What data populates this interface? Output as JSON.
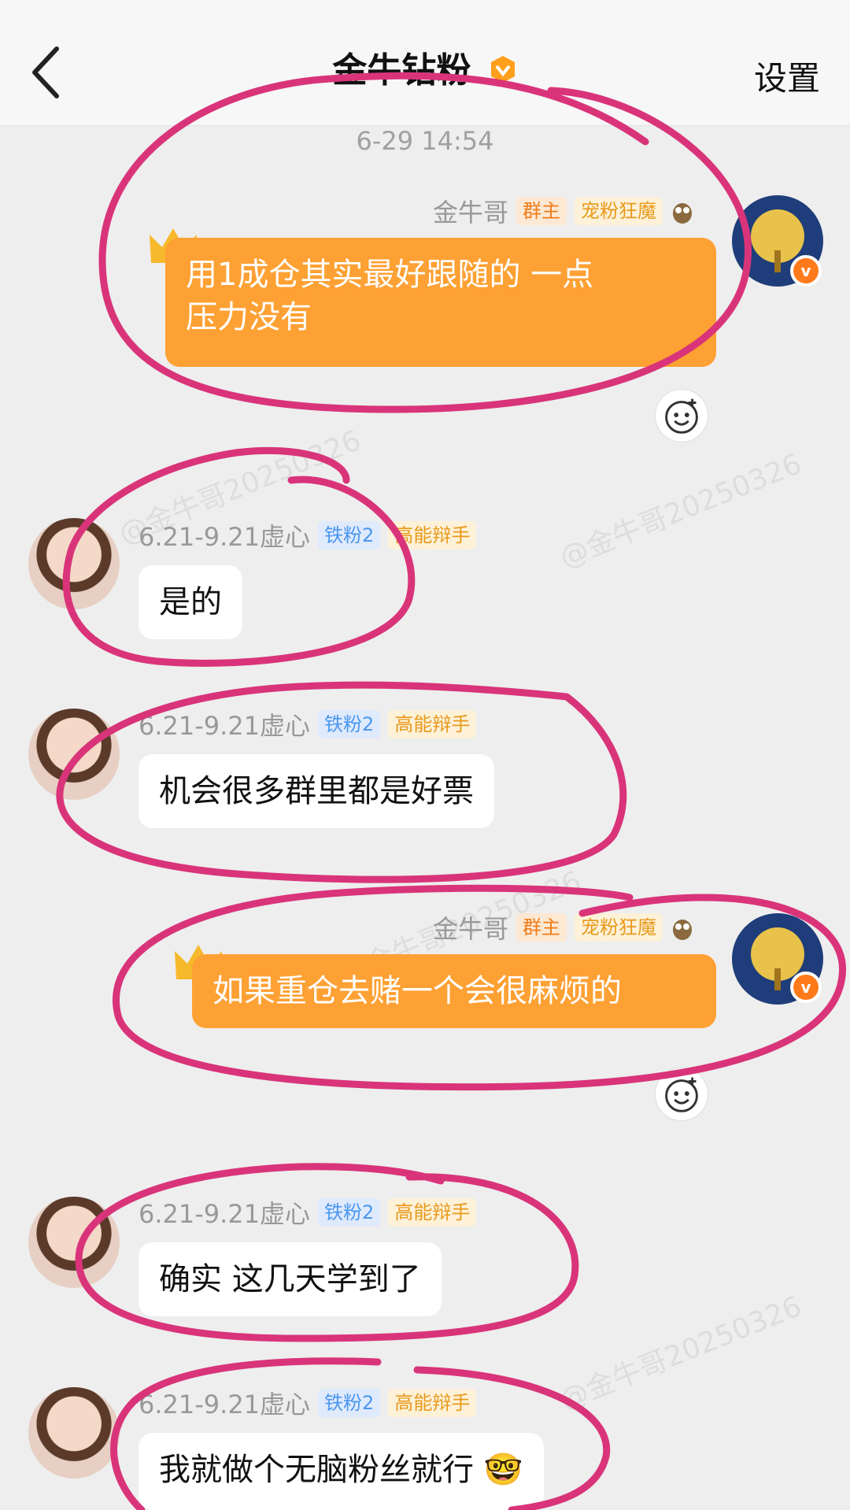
{
  "header": {
    "title": "金牛钻粉",
    "settings_label": "设置"
  },
  "timestamp": "6-29 14:54",
  "watermark": "@金牛哥20250326",
  "messages": [
    {
      "sender": "金牛哥",
      "tags": [
        "群主",
        "宠粉狂魔"
      ],
      "text_line1": "用1成仓其实最好跟随的 一点",
      "text_line2": "压力没有"
    },
    {
      "sender": "6.21-9.21虚心",
      "tags": [
        "铁粉2",
        "高能辩手"
      ],
      "text": "是的"
    },
    {
      "sender": "6.21-9.21虚心",
      "tags": [
        "铁粉2",
        "高能辩手"
      ],
      "text": "机会很多群里都是好票"
    },
    {
      "sender": "金牛哥",
      "tags": [
        "群主",
        "宠粉狂魔"
      ],
      "text": "如果重仓去赌一个会很麻烦的"
    },
    {
      "sender": "6.21-9.21虚心",
      "tags": [
        "铁粉2",
        "高能辩手"
      ],
      "text": "确实 这几天学到了"
    },
    {
      "sender": "6.21-9.21虚心",
      "tags": [
        "铁粉2",
        "高能辩手"
      ],
      "text": "我就做个无脑粉丝就行"
    }
  ]
}
